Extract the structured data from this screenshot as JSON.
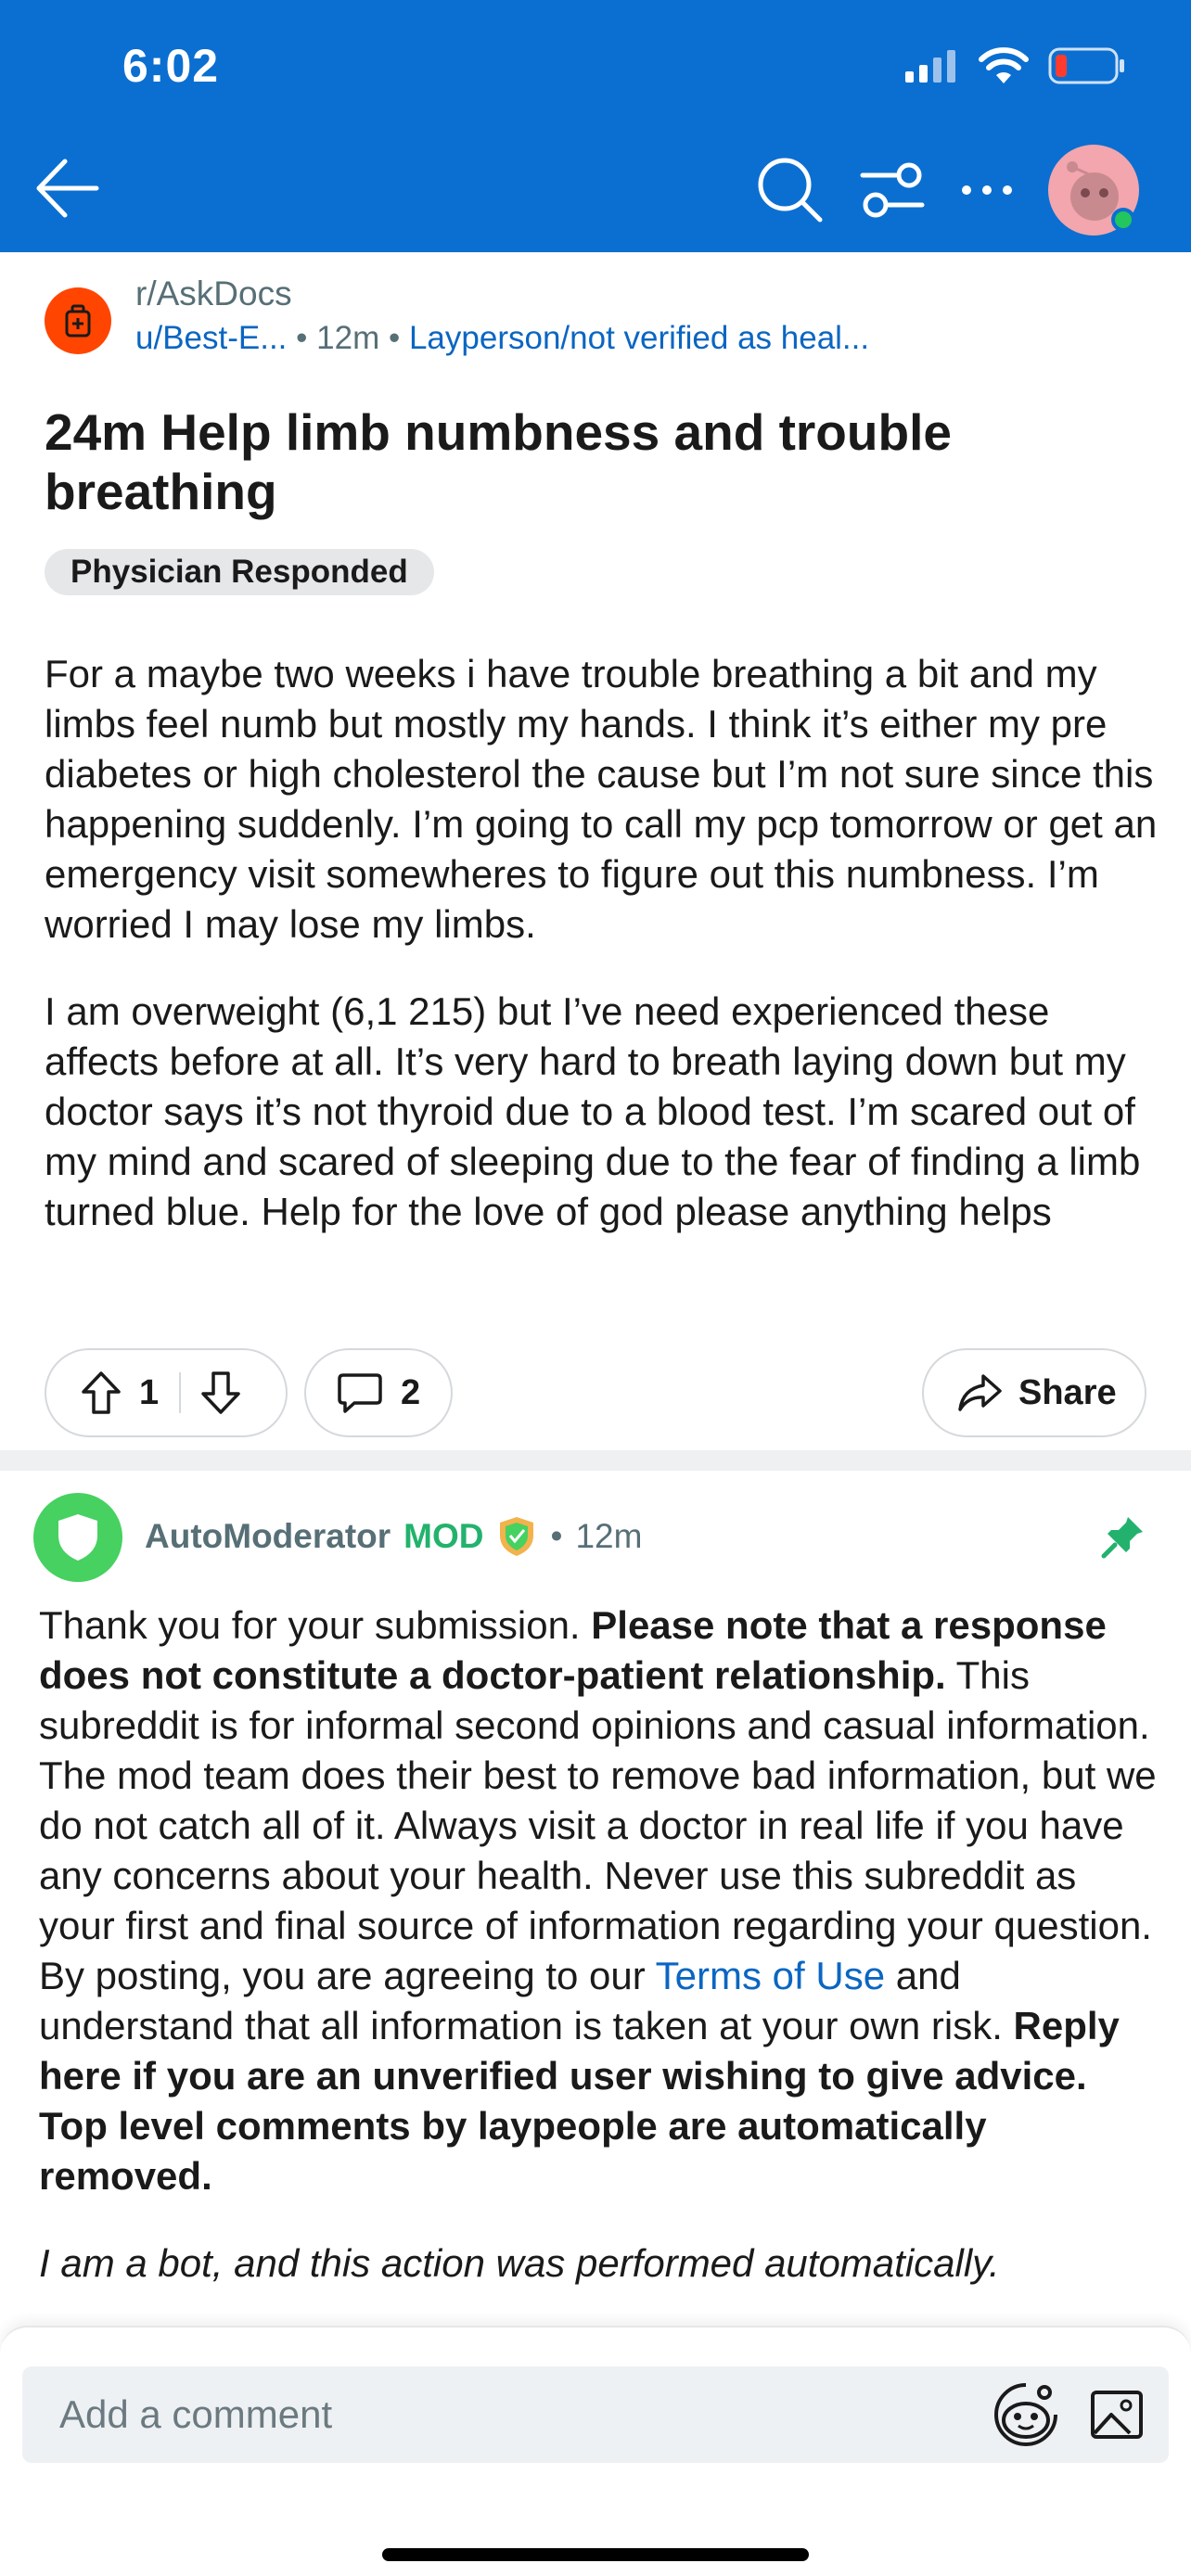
{
  "status_bar": {
    "time": "6:02"
  },
  "post": {
    "subreddit": "r/AskDocs",
    "author": "u/Best-E...",
    "age": "12m",
    "separator": "•",
    "flair": "Layperson/not verified as heal...",
    "title": "24m Help limb numbness and trouble breathing",
    "badge": "Physician Responded",
    "paragraphs": [
      "For a maybe two weeks i have trouble breathing a bit and my limbs feel numb but mostly my hands. I think it’s either my pre diabetes or high cholesterol the cause but I’m not sure since this happening suddenly. I’m going to call my pcp tomorrow or get an emergency visit somewheres to figure out this numbness. I’m worried I may lose my limbs.",
      "I am overweight (6,1 215) but I’ve need experienced these affects before at all. It’s very hard to breath laying down but my doctor says it’s not thyroid due to a blood test. I’m scared out of my mind and scared of sleeping due to the fear of finding a limb turned blue. Help for the love of god please anything helps"
    ],
    "votes": "1",
    "comments": "2",
    "share_label": "Share"
  },
  "comment": {
    "author": "AutoModerator",
    "mod_label": "MOD",
    "separator": "•",
    "age": "12m",
    "body": {
      "t1": "Thank you for your submission. ",
      "b1": "Please note that a response does not constitute a doctor-patient relationship.",
      "t2": " This subreddit is for informal second opinions and casual information. The mod team does their best to remove bad information, but we do not catch all of it. Always visit a doctor in real life if you have any concerns about your health. Never use this subreddit as your first and final source of information regarding your question. By posting, you are agreeing to our ",
      "link": "Terms of Use",
      "t3": " and understand that all information is taken at your own risk. ",
      "b2": "Reply here if you are an unverified user wishing to give advice. Top level comments by laypeople are automatically removed.",
      "bot": "I am a bot, and this action was performed automatically."
    }
  },
  "bottom": {
    "placeholder": "Add a comment"
  },
  "colors": {
    "header": "#0b6fd1",
    "link": "#0a66c2",
    "mod": "#23b26d",
    "subreddit_icon": "#ff4500"
  }
}
